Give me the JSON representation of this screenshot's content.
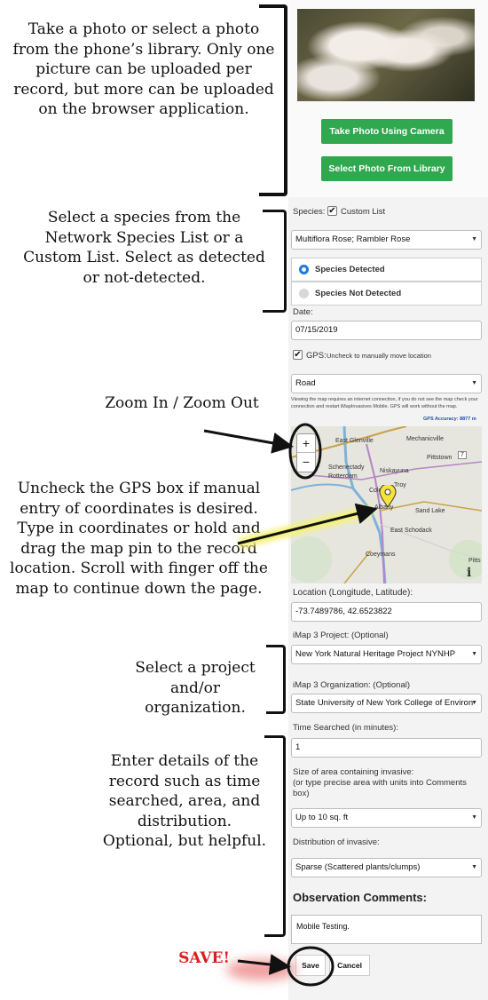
{
  "annotations": {
    "photo": "Take a photo or select a photo from the phone’s library. Only one picture can be uploaded per record, but more can be uploaded on the browser application.",
    "species": "Select a species from the Network Species List or a Custom List. Select as detected or not-detected.",
    "zoom": "Zoom In / Zoom Out",
    "gps": "Uncheck the GPS box if manual entry of coordinates is desired. Type in coordinates or hold and drag the map pin to the record location. Scroll with finger off the map to continue down the page.",
    "project": "Select a project and/or organization.",
    "details": "Enter details of the record such as time searched, area, and distribution. Optional, but helpful.",
    "save": "SAVE!"
  },
  "photo_buttons": {
    "camera": "Take Photo Using Camera",
    "library": "Select Photo From Library"
  },
  "species": {
    "label": "Species:",
    "custom_list_label": "Custom List",
    "custom_list_checked": true,
    "selected": "Multiflora Rose; Rambler Rose",
    "detected_label": "Species Detected",
    "not_detected_label": "Species Not Detected",
    "detected_selected": true
  },
  "date": {
    "label": "Date:",
    "value": "07/15/2019"
  },
  "gps": {
    "label": "GPS:",
    "hint": "Uncheck to manually move location",
    "checked": true,
    "map_type": "Road",
    "note": "Viewing the map requires an internet connection, if you do not see the map check your connection and restart iMapInvasives Mobile. GPS will work without the map.",
    "accuracy": "GPS Accuracy: 8877 m"
  },
  "map": {
    "zoom_in": "+",
    "zoom_out": "−",
    "info": "i",
    "places": {
      "east_glenville": "East Glenville",
      "mechanicville": "Mechanicville",
      "pittstown": "Pittstown",
      "schenectady": "Schenectady",
      "niskayuna": "Niskayuna",
      "rotterdam": "Rotterdam",
      "colonie": "Colonie",
      "troy": "Troy",
      "albany": "Albany",
      "sand_lake": "Sand Lake",
      "east_schodack": "East Schodack",
      "coeymans": "Coeymans",
      "pitts": "Pitts"
    },
    "route_7": "7"
  },
  "location": {
    "label": "Location (Longitude, Latitude):",
    "value": "-73.7489786, 42.6523822"
  },
  "project": {
    "label": "iMap 3 Project: (Optional)",
    "value": "New York Natural Heritage Project NYNHP"
  },
  "organization": {
    "label": "iMap 3 Organization: (Optional)",
    "value": "State University of New York College of Environ"
  },
  "time_searched": {
    "label": "Time Searched (in minutes):",
    "value": "1"
  },
  "area": {
    "label_line1": "Size of area containing invasive:",
    "label_line2": "(or type precise area with units into Comments box)",
    "value": "Up to 10 sq. ft"
  },
  "distribution": {
    "label": "Distribution of invasive:",
    "value": "Sparse (Scattered plants/clumps)"
  },
  "comments": {
    "title": "Observation Comments:",
    "value": "Mobile Testing."
  },
  "actions": {
    "save": "Save",
    "cancel": "Cancel"
  },
  "colors": {
    "green_button": "#2fa84f",
    "radio_accent": "#1e7ad8",
    "save_annotation": "#d62020",
    "gps_arrow_highlight": "#f6f27a"
  }
}
